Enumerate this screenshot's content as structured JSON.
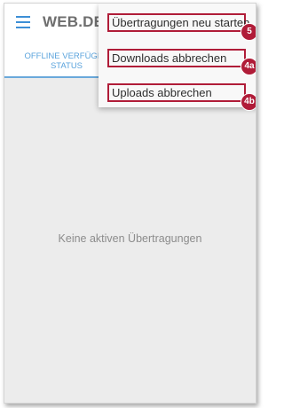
{
  "app": {
    "title": "WEB.DE"
  },
  "tabs": [
    {
      "label": "OFFLINE VERFÜGBA\nSTATUS"
    }
  ],
  "main": {
    "empty_message": "Keine aktiven Übertragungen"
  },
  "menu": {
    "items": [
      {
        "label": "Übertragungen neu starten",
        "badge": "5"
      },
      {
        "label": "Downloads abbrechen",
        "badge": "4a"
      },
      {
        "label": "Uploads abbrechen",
        "badge": "4b"
      }
    ]
  },
  "colors": {
    "accent": "#3d8fd6",
    "highlight": "#b01c38",
    "tab_text": "#5aa3dc"
  },
  "icons": {
    "menu": "hamburger-icon"
  }
}
